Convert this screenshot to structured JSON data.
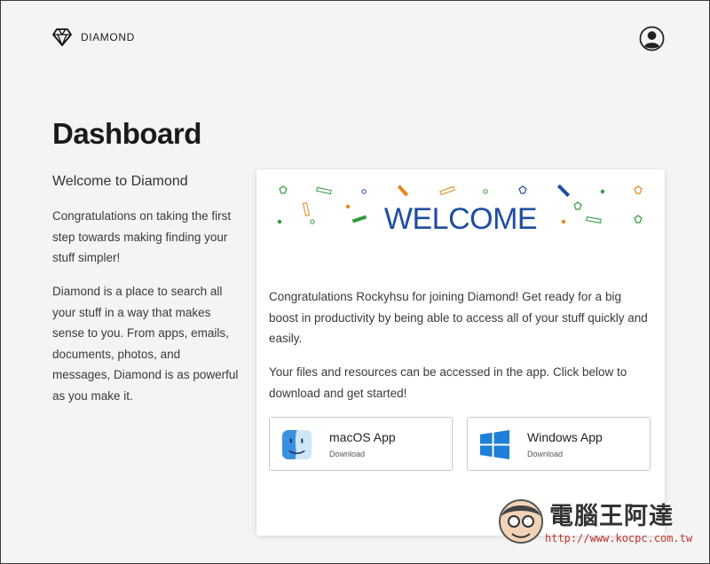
{
  "header": {
    "brand_name": "DIAMOND",
    "logo_icon": "diamond-icon",
    "account_icon": "user-circle-icon"
  },
  "sidebar": {
    "title": "Dashboard",
    "welcome_heading": "Welcome to Diamond",
    "paragraph_1": "Congratulations on taking the first step towards making finding your stuff simpler!",
    "paragraph_2": "Diamond is a place to search all your stuff in a way that makes sense to you. From apps, emails, documents, photos, and messages, Diamond is as powerful as you make it."
  },
  "card": {
    "banner_text": "WELCOME",
    "message_1": "Congratulations Rockyhsu for joining Diamond! Get ready for a big boost in productivity by being able to access all of your stuff quickly and easily.",
    "message_2": "Your files and resources can be accessed in the app. Click below to download and get started!",
    "downloads": [
      {
        "label": "macOS App",
        "sublabel": "Download",
        "icon": "finder-icon"
      },
      {
        "label": "Windows App",
        "sublabel": "Download",
        "icon": "windows-icon"
      }
    ]
  },
  "watermark": {
    "text": "電腦王阿達",
    "url": "http://www.kocpc.com.tw"
  },
  "colors": {
    "background": "#f4f4f4",
    "banner_blue": "#1f4ea0",
    "confetti_orange": "#e8841a",
    "confetti_green": "#2e9a3a",
    "confetti_navy": "#1f4ea0",
    "watermark_red": "#c2352a"
  }
}
